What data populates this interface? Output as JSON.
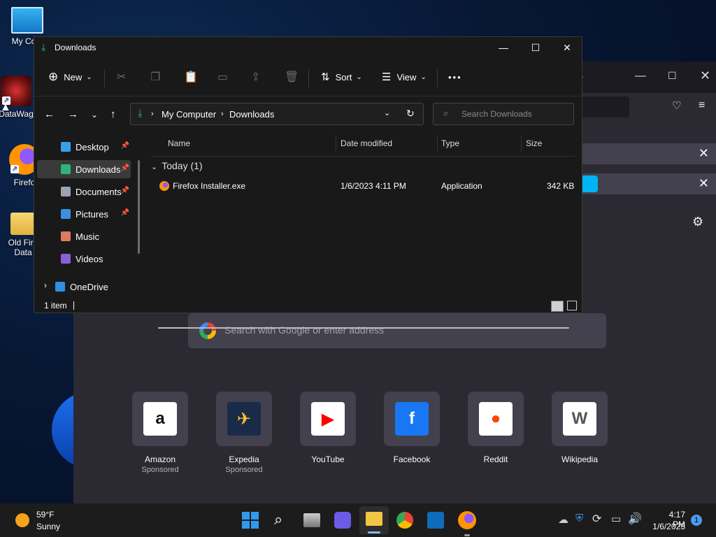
{
  "desktop": {
    "icons": [
      {
        "label": "My Com",
        "icon": "monitor-icon"
      },
      {
        "label": "DataWag",
        "icon": "datawag-icon"
      },
      {
        "label": "Firefo",
        "icon": "firefox-icon"
      },
      {
        "label": "Old Fire",
        "label2": "Data",
        "icon": "folder-icon"
      }
    ]
  },
  "explorer": {
    "title": "Downloads",
    "toolbar": {
      "new": "New",
      "sort": "Sort",
      "view": "View",
      "more": "•••"
    },
    "breadcrumb": {
      "root": "My Computer",
      "current": "Downloads"
    },
    "search_placeholder": "Search Downloads",
    "sidebar": [
      {
        "label": "Desktop",
        "color": "#3aa0e8",
        "pinned": true
      },
      {
        "label": "Downloads",
        "color": "#2fb57a",
        "pinned": true,
        "selected": true
      },
      {
        "label": "Documents",
        "color": "#9aa4b0",
        "pinned": true
      },
      {
        "label": "Pictures",
        "color": "#3b8fe0",
        "pinned": true
      },
      {
        "label": "Music",
        "color": "#e07a5f",
        "pinned": false
      },
      {
        "label": "Videos",
        "color": "#8a5fd6",
        "pinned": false
      },
      {
        "label": "OneDrive",
        "color": "#2f8fe0",
        "pinned": false
      }
    ],
    "columns": {
      "name": "Name",
      "date": "Date modified",
      "type": "Type",
      "size": "Size"
    },
    "group": "Today (1)",
    "files": [
      {
        "name": "Firefox Installer.exe",
        "date": "1/6/2023 4:11 PM",
        "type": "Application",
        "size": "342 KB"
      }
    ],
    "status": "1 item"
  },
  "firefox": {
    "search_placeholder": "Search with Google or enter address",
    "sites": [
      {
        "name": "Amazon",
        "sponsored": "Sponsored",
        "letter": "a",
        "bg": "#ffffff",
        "fg": "#111111"
      },
      {
        "name": "Expedia",
        "sponsored": "Sponsored",
        "letter": "✈",
        "bg": "#1a2b49",
        "fg": "#ffc72c"
      },
      {
        "name": "YouTube",
        "sponsored": "",
        "letter": "▶",
        "bg": "#ffffff",
        "fg": "#ff0000"
      },
      {
        "name": "Facebook",
        "sponsored": "",
        "letter": "f",
        "bg": "#1877f2",
        "fg": "#ffffff"
      },
      {
        "name": "Reddit",
        "sponsored": "",
        "letter": "●",
        "bg": "#ffffff",
        "fg": "#ff4500"
      },
      {
        "name": "Wikipedia",
        "sponsored": "",
        "letter": "W",
        "bg": "#ffffff",
        "fg": "#555555"
      }
    ]
  },
  "taskbar": {
    "weather_temp": "59°F",
    "weather_desc": "Sunny",
    "time": "4:17 PM",
    "date": "1/6/2023",
    "notifications": "1"
  }
}
